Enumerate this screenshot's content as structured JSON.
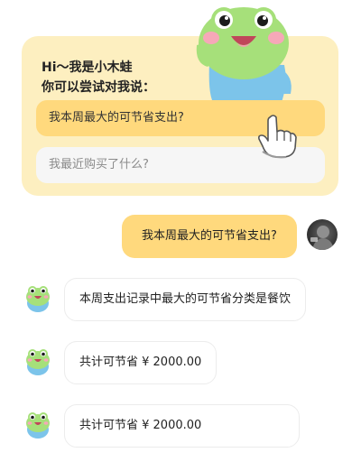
{
  "intro": {
    "greeting_line1": "Hi～我是小木蛙",
    "greeting_line2": "你可以尝试对我说：",
    "suggestions": [
      "我本周最大的可节省支出?",
      "我最近购买了什么?"
    ]
  },
  "chat": {
    "user_message": "我本周最大的可节省支出?",
    "bot_messages": [
      "本周支出记录中最大的可节省分类是餐饮",
      "共计可节省 ¥ 2000.00",
      "共计可节省 ¥ 2000.00"
    ]
  },
  "colors": {
    "card_bg": "#fdefc0",
    "accent_yellow": "#ffd97d",
    "frog_green": "#a6e07a",
    "frog_shirt": "#7cc4ea"
  },
  "icons": {
    "hero": "frog-mascot-icon",
    "pointer": "pointing-hand-icon",
    "bot_avatar": "frog-avatar-icon"
  }
}
